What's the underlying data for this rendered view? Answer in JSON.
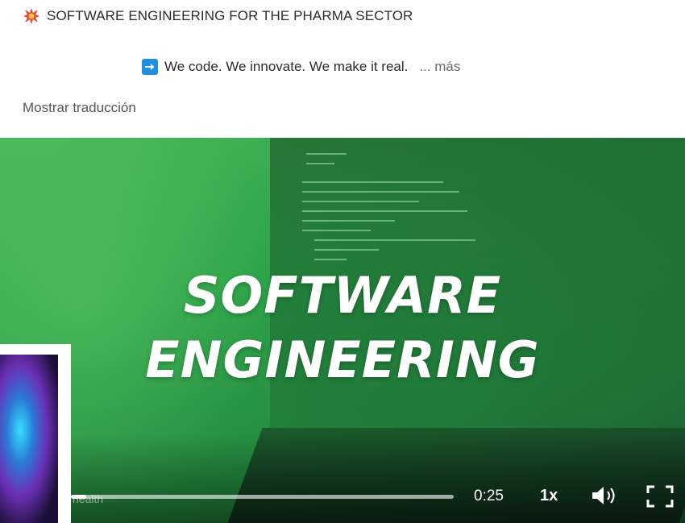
{
  "post": {
    "header_text": "SOFTWARE ENGINEERING FOR THE PHARMA SECTOR",
    "tagline": "We code. We innovate. We make it real.",
    "more_label": "... más",
    "translate_label": "Mostrar traducción",
    "icons": [
      "collision-icon",
      "right-arrow-icon"
    ]
  },
  "video": {
    "title_line1": "SOFTWARE",
    "title_line2": "ENGINEERING",
    "watermark": "health",
    "time": "0:25",
    "speed": "1x",
    "progress_percent": 4,
    "accent_color": "#2ea54a"
  }
}
